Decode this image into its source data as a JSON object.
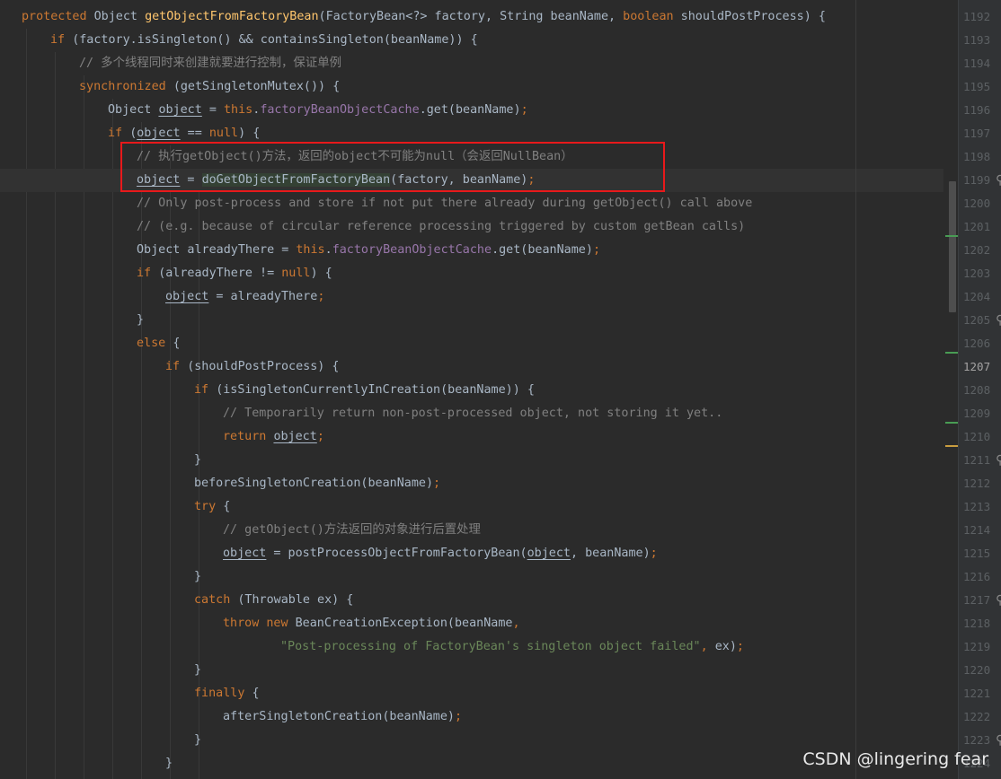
{
  "editor": {
    "first_line_number": 1192,
    "current_line_number": 1207,
    "lines": [
      {
        "indent": 0,
        "tokens": [
          {
            "t": "protected ",
            "k": "kw"
          },
          {
            "t": "Object "
          },
          {
            "t": "getObjectFromFactoryBean",
            "k": "fn"
          },
          {
            "t": "(FactoryBean<?> factory, String beanName, "
          },
          {
            "t": "boolean ",
            "k": "kw"
          },
          {
            "t": "shouldPostProcess) {"
          }
        ]
      },
      {
        "indent": 1,
        "tokens": [
          {
            "t": "if ",
            "k": "kw"
          },
          {
            "t": "(factory.isSingleton() && containsSingleton(beanName)) {"
          }
        ]
      },
      {
        "indent": 2,
        "tokens": [
          {
            "t": "// 多个线程同时来创建就要进行控制，保证单例",
            "k": "cmt"
          }
        ]
      },
      {
        "indent": 2,
        "tokens": [
          {
            "t": "synchronized ",
            "k": "kw"
          },
          {
            "t": "(getSingletonMutex()) {"
          }
        ]
      },
      {
        "indent": 3,
        "tokens": [
          {
            "t": "Object "
          },
          {
            "t": "object",
            "k": "uvar"
          },
          {
            "t": " = "
          },
          {
            "t": "this",
            "k": "kw"
          },
          {
            "t": "."
          },
          {
            "t": "factoryBeanObjectCache",
            "k": "fld"
          },
          {
            "t": ".get(beanName)"
          },
          {
            "t": ";",
            "k": "kw"
          }
        ]
      },
      {
        "indent": 3,
        "tokens": [
          {
            "t": "if ",
            "k": "kw"
          },
          {
            "t": "("
          },
          {
            "t": "object",
            "k": "uvar"
          },
          {
            "t": " == "
          },
          {
            "t": "null",
            "k": "kw"
          },
          {
            "t": ") {"
          }
        ]
      },
      {
        "indent": 4,
        "tokens": [
          {
            "t": "// 执行getObject()方法，返回的object不可能为null（会返回NullBean）",
            "k": "cmt"
          }
        ]
      },
      {
        "indent": 4,
        "tokens": [
          {
            "t": "object",
            "k": "uvar"
          },
          {
            "t": " = "
          },
          {
            "t": "doGetObjectFromFactoryBean",
            "k": "hl"
          },
          {
            "t": "(factory, beanName)"
          },
          {
            "t": ";",
            "k": "kw"
          }
        ]
      },
      {
        "indent": 4,
        "tokens": [
          {
            "t": "// Only post-process and store if not put there already during getObject() call above",
            "k": "cmt"
          }
        ]
      },
      {
        "indent": 4,
        "tokens": [
          {
            "t": "// (e.g. because of circular reference processing triggered by custom getBean calls)",
            "k": "cmt"
          }
        ]
      },
      {
        "indent": 4,
        "tokens": [
          {
            "t": "Object alreadyThere = "
          },
          {
            "t": "this",
            "k": "kw"
          },
          {
            "t": "."
          },
          {
            "t": "factoryBeanObjectCache",
            "k": "fld"
          },
          {
            "t": ".get(beanName)"
          },
          {
            "t": ";",
            "k": "kw"
          }
        ]
      },
      {
        "indent": 4,
        "tokens": [
          {
            "t": "if ",
            "k": "kw"
          },
          {
            "t": "(alreadyThere != "
          },
          {
            "t": "null",
            "k": "kw"
          },
          {
            "t": ") {"
          }
        ]
      },
      {
        "indent": 5,
        "tokens": [
          {
            "t": "object",
            "k": "uvar"
          },
          {
            "t": " = alreadyThere"
          },
          {
            "t": ";",
            "k": "kw"
          }
        ]
      },
      {
        "indent": 4,
        "tokens": [
          {
            "t": "}"
          }
        ]
      },
      {
        "indent": 4,
        "tokens": [
          {
            "t": "else ",
            "k": "kw"
          },
          {
            "t": "{"
          }
        ]
      },
      {
        "indent": 5,
        "tokens": [
          {
            "t": "if ",
            "k": "kw"
          },
          {
            "t": "(shouldPostProcess) {"
          }
        ]
      },
      {
        "indent": 6,
        "tokens": [
          {
            "t": "if ",
            "k": "kw"
          },
          {
            "t": "(isSingletonCurrentlyInCreation(beanName)) {"
          }
        ]
      },
      {
        "indent": 7,
        "tokens": [
          {
            "t": "// Temporarily return non-post-processed object, not storing it yet..",
            "k": "cmt"
          }
        ]
      },
      {
        "indent": 7,
        "tokens": [
          {
            "t": "return ",
            "k": "kw"
          },
          {
            "t": "object",
            "k": "uvar"
          },
          {
            "t": ";",
            "k": "kw"
          }
        ]
      },
      {
        "indent": 6,
        "tokens": [
          {
            "t": "}"
          }
        ]
      },
      {
        "indent": 6,
        "tokens": [
          {
            "t": "beforeSingletonCreation(beanName)"
          },
          {
            "t": ";",
            "k": "kw"
          }
        ]
      },
      {
        "indent": 6,
        "tokens": [
          {
            "t": "try ",
            "k": "kw"
          },
          {
            "t": "{"
          }
        ]
      },
      {
        "indent": 7,
        "tokens": [
          {
            "t": "// getObject()方法返回的对象进行后置处理",
            "k": "cmt"
          }
        ]
      },
      {
        "indent": 7,
        "tokens": [
          {
            "t": "object",
            "k": "uvar"
          },
          {
            "t": " = postProcessObjectFromFactoryBean("
          },
          {
            "t": "object",
            "k": "uvar"
          },
          {
            "t": ", beanName)"
          },
          {
            "t": ";",
            "k": "kw"
          }
        ]
      },
      {
        "indent": 6,
        "tokens": [
          {
            "t": "}"
          }
        ]
      },
      {
        "indent": 6,
        "tokens": [
          {
            "t": "catch ",
            "k": "kw"
          },
          {
            "t": "(Throwable ex) {"
          }
        ]
      },
      {
        "indent": 7,
        "tokens": [
          {
            "t": "throw new ",
            "k": "kw"
          },
          {
            "t": "BeanCreationException(beanName"
          },
          {
            "t": ",",
            "k": "kw"
          }
        ]
      },
      {
        "indent": 9,
        "tokens": [
          {
            "t": "\"Post-processing of FactoryBean's singleton object failed\"",
            "k": "str"
          },
          {
            "t": ",",
            "k": "kw"
          },
          {
            "t": " ex)"
          },
          {
            "t": ";",
            "k": "kw"
          }
        ]
      },
      {
        "indent": 6,
        "tokens": [
          {
            "t": "}"
          }
        ]
      },
      {
        "indent": 6,
        "tokens": [
          {
            "t": "finally ",
            "k": "kw"
          },
          {
            "t": "{"
          }
        ]
      },
      {
        "indent": 7,
        "tokens": [
          {
            "t": "afterSingletonCreation(beanName)"
          },
          {
            "t": ";",
            "k": "kw"
          }
        ]
      },
      {
        "indent": 6,
        "tokens": [
          {
            "t": "}"
          }
        ]
      },
      {
        "indent": 5,
        "tokens": [
          {
            "t": "}"
          }
        ]
      }
    ]
  },
  "scroll_markers": [
    {
      "line_index": 9,
      "color": "#499c54"
    },
    {
      "line_index": 14,
      "color": "#499c54"
    },
    {
      "line_index": 17,
      "color": "#499c54"
    },
    {
      "line_index": 18,
      "color": "#c99d3f"
    }
  ],
  "gutter_icons": [
    {
      "line_index": 7,
      "icon": "annotation-bulb-icon"
    },
    {
      "line_index": 13,
      "icon": "annotation-bulb-icon"
    },
    {
      "line_index": 19,
      "icon": "annotation-bulb-icon"
    },
    {
      "line_index": 25,
      "icon": "annotation-bulb-icon"
    },
    {
      "line_index": 31,
      "icon": "annotation-bulb-icon"
    }
  ],
  "highlight_box": {
    "color": "#e8191b"
  },
  "watermark": "CSDN @lingering fear"
}
